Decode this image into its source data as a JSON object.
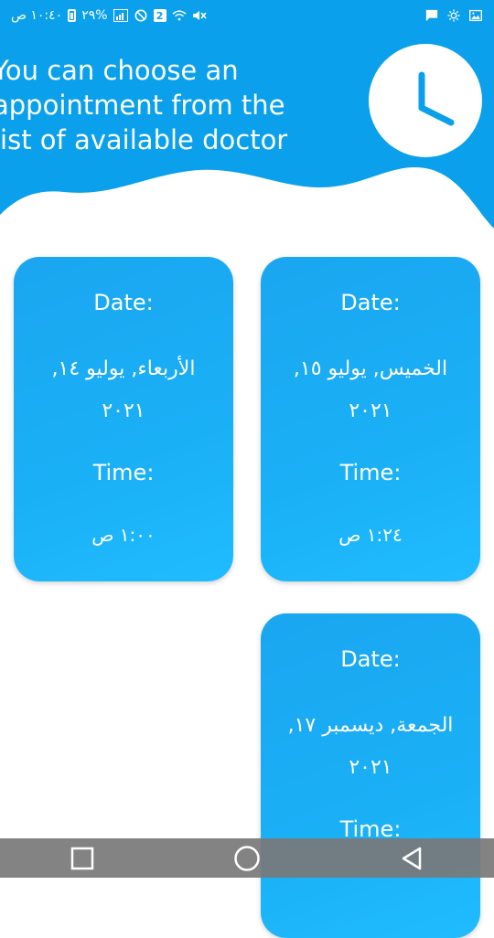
{
  "theme": {
    "primary": "#1aa6f0",
    "header": "#0aa0eb"
  },
  "status_bar": {
    "time": "١٠:٤٠ ص",
    "battery": "٢٩%",
    "notification_count": "2",
    "icons": [
      "battery-icon",
      "signal-icon",
      "dnd-icon",
      "sim-icon",
      "wifi-icon",
      "mute-icon",
      "message-icon",
      "brightness-icon",
      "image-icon"
    ]
  },
  "header": {
    "line1": "You can choose an",
    "line2": "appointment from the",
    "line3": "list of available doctor",
    "icon": "clock-icon"
  },
  "appointments": [
    {
      "date_label": "Date:",
      "date_value": "الأربعاء, يوليو ١٤, ٢٠٢١",
      "time_label": "Time:",
      "time_value": "١:٠٠ ص"
    },
    {
      "date_label": "Date:",
      "date_value": "الخميس, يوليو ١٥, ٢٠٢١",
      "time_label": "Time:",
      "time_value": "١:٢٤ ص"
    },
    {
      "date_label": "Date:",
      "date_value": "الجمعة, ديسمبر ١٧, ٢٠٢١",
      "time_label": "Time:",
      "time_value": ""
    }
  ],
  "nav_bar": {
    "icons": [
      "recents-icon",
      "home-icon",
      "back-icon"
    ]
  }
}
